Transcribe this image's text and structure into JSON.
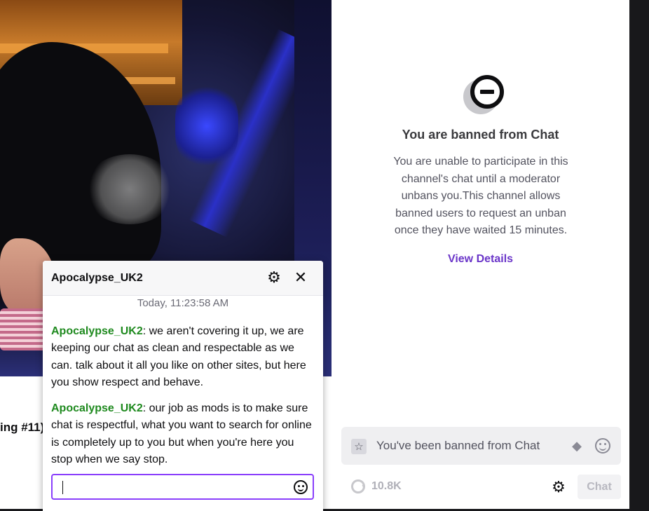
{
  "stream": {
    "title_fragment": "ing #11)"
  },
  "ban_panel": {
    "icon": "ban-circle-icon",
    "title": "You are banned from Chat",
    "description": "You are unable to participate in this channel's chat until a moderator unbans you.This channel allows banned users to request an unban once they have waited 15 minutes.",
    "view_details_label": "View Details"
  },
  "chat_input": {
    "placeholder": "You've been banned from Chat",
    "left_icon": "star-icon",
    "bits_icon": "bits-icon",
    "emote_icon": "emote-icon"
  },
  "chat_footer": {
    "points_value": "10.8K",
    "chat_button_label": "Chat"
  },
  "viewer_card": {
    "username": "Apocalypse_UK2",
    "timestamp": "Today, 11:23:58 AM",
    "messages": [
      {
        "author": "Apocalypse_UK2",
        "text": ": we aren't covering it up, we are keeping our chat as clean and respectable as we can. talk about it all you like on other sites, but here you show respect and behave."
      },
      {
        "author": "Apocalypse_UK2",
        "text": ": our job as mods is to make sure chat is respectful, what you want to search for online is completely up to you but when you're here you stop when we say stop."
      }
    ],
    "reply_value": ""
  },
  "colors": {
    "accent": "#8a3ffc",
    "link": "#6b36c9",
    "username": "#1f8a1f"
  }
}
